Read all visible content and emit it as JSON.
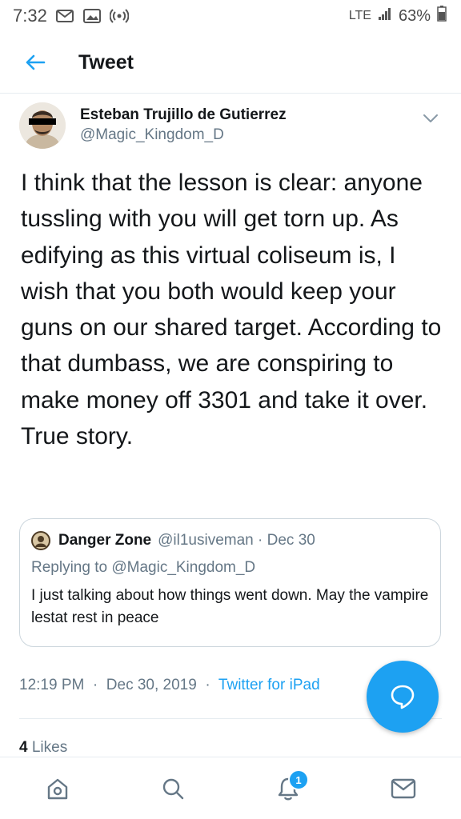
{
  "status_bar": {
    "time": "7:32",
    "network": "LTE",
    "battery": "63%"
  },
  "header": {
    "title": "Tweet"
  },
  "tweet": {
    "author_name": "Esteban Trujillo de Gutierrez",
    "author_handle": "@Magic_Kingdom_D",
    "text": "I think that the lesson is clear: anyone tussling with you will get torn up. As edifying as this virtual coliseum is, I wish that you both would keep your guns on our shared target. According to that dumbass, we are conspiring to make money off 3301 and take it over. True story.",
    "time": "12:19 PM",
    "date": "Dec 30, 2019",
    "source": "Twitter for iPad",
    "likes_count": "4",
    "likes_label": "Likes"
  },
  "quote": {
    "name": "Danger Zone",
    "handle": "@il1usiveman",
    "date": "Dec 30",
    "replying_prefix": "Replying to",
    "replying_handle": "@Magic_Kingdom_D",
    "text": "I just talking about how things went down. May the vampire lestat rest in peace"
  },
  "bottom_nav": {
    "notification_badge": "1"
  },
  "colors": {
    "accent": "#1da1f2",
    "text": "#14171a",
    "secondary_text": "#657786",
    "border": "#e6ecf0"
  },
  "icons": [
    "gmail-icon",
    "gallery-icon",
    "hotspot-icon",
    "signal-icon",
    "battery-icon",
    "back-arrow-icon",
    "chevron-down-icon",
    "compose-reply-icon",
    "home-icon",
    "search-icon",
    "bell-icon",
    "mail-icon"
  ]
}
